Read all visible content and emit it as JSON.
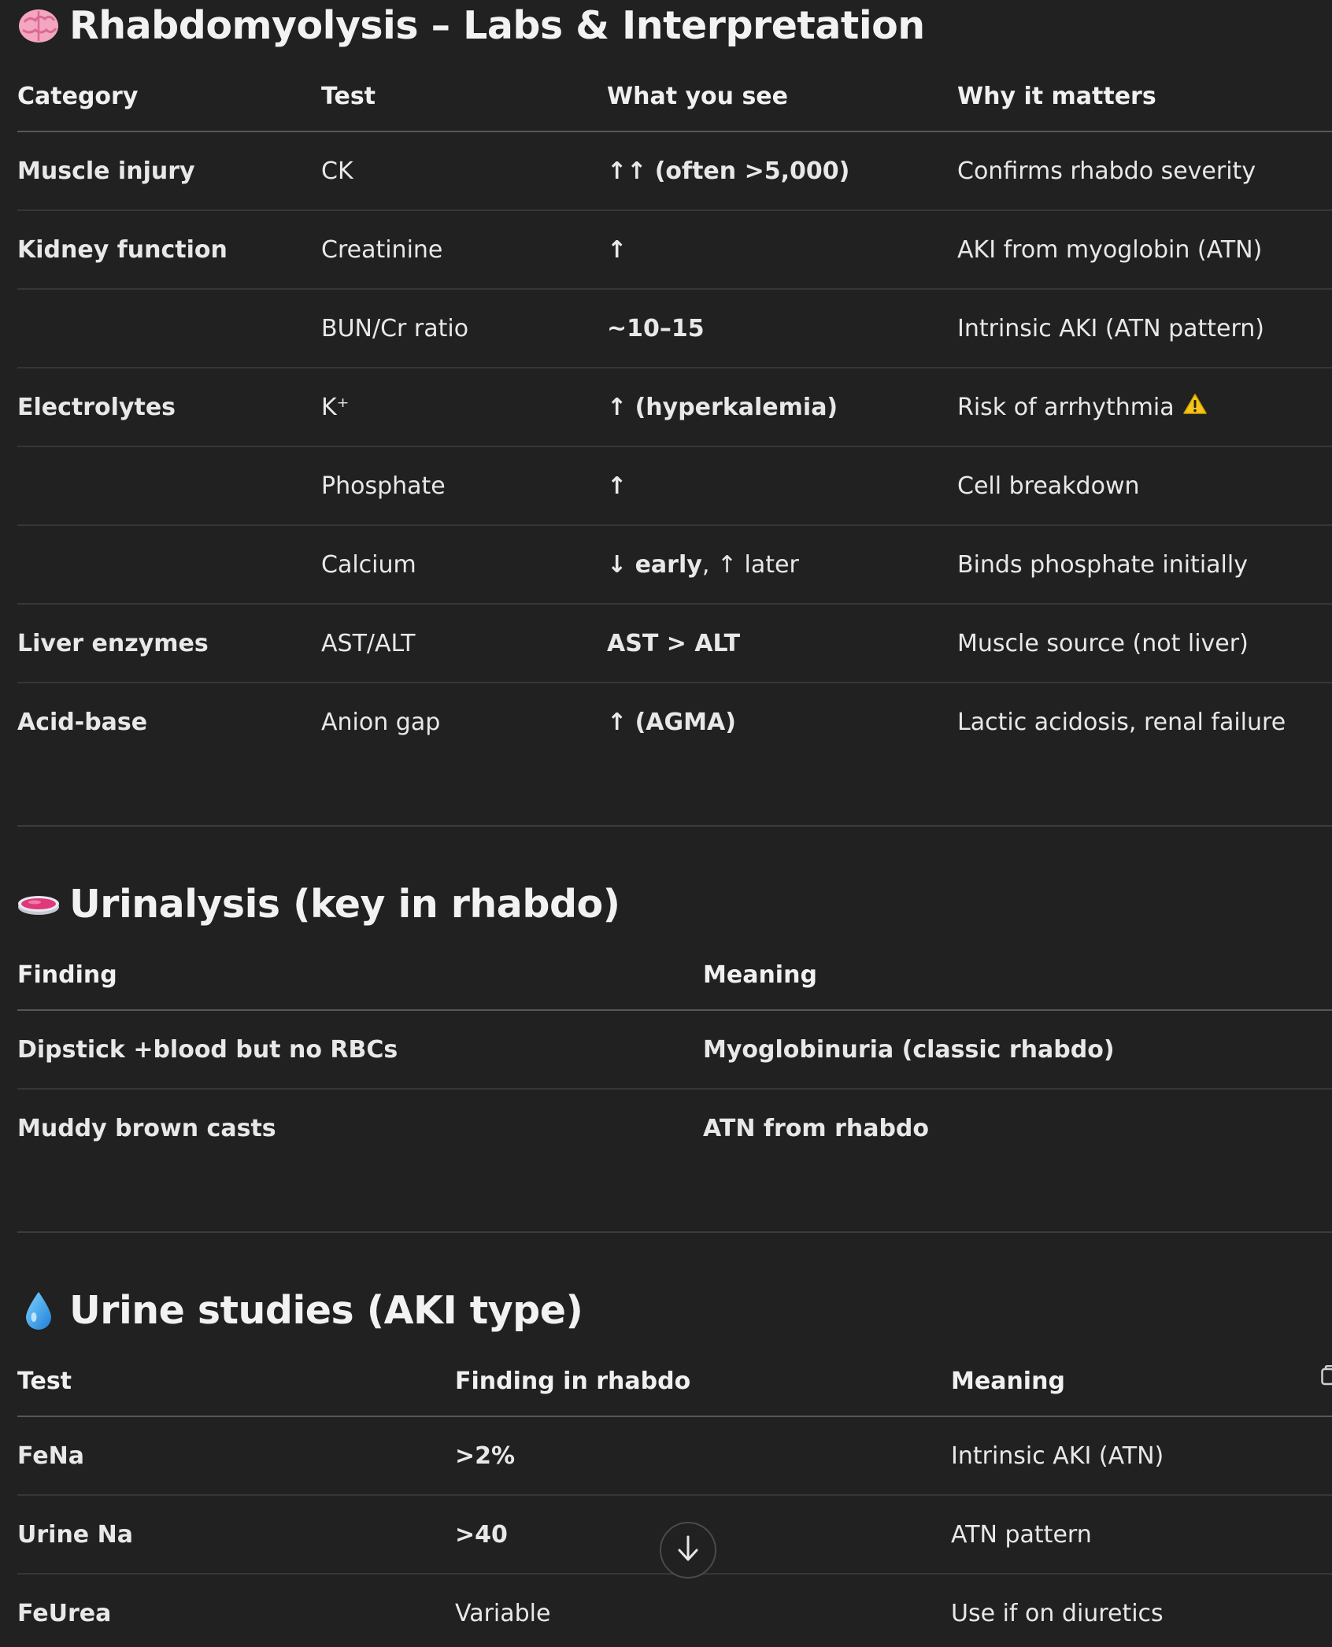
{
  "section1": {
    "emoji": "brain-icon",
    "title": "Rhabdomyolysis – Labs & Interpretation",
    "headers": [
      "Category",
      "Test",
      "What you see",
      "Why it matters"
    ],
    "rows": [
      {
        "category": "Muscle injury",
        "test": "CK",
        "see": "↑↑ (often >5,000)",
        "why": "Confirms rhabdo severity"
      },
      {
        "category": "Kidney function",
        "test": "Creatinine",
        "see": "↑",
        "why": "AKI from myoglobin (ATN)"
      },
      {
        "category": "",
        "test": "BUN/Cr ratio",
        "see": "~10–15",
        "why": "Intrinsic AKI (ATN pattern)"
      },
      {
        "category": "Electrolytes",
        "test": "K⁺",
        "see": "↑ (hyperkalemia)",
        "why": "Risk of arrhythmia"
      },
      {
        "category": "",
        "test": "Phosphate",
        "see": "↑",
        "why": "Cell breakdown"
      },
      {
        "category": "",
        "test": "Calcium",
        "see_bold": "↓ early",
        "see_rest": ", ↑ later",
        "why": "Binds phosphate initially"
      },
      {
        "category": "Liver enzymes",
        "test": "AST/ALT",
        "see": "AST > ALT",
        "why": "Muscle source (not liver)"
      },
      {
        "category": "Acid-base",
        "test": "Anion gap",
        "see": "↑ (AGMA)",
        "why": "Lactic acidosis, renal failure"
      }
    ],
    "warning_icon": "warning-icon"
  },
  "section2": {
    "emoji": "petri-dish-icon",
    "title": "Urinalysis (key in rhabdo)",
    "headers": [
      "Finding",
      "Meaning"
    ],
    "rows": [
      {
        "finding": "Dipstick +blood but no RBCs",
        "meaning": "Myoglobinuria (classic rhabdo)"
      },
      {
        "finding": "Muddy brown casts",
        "meaning": "ATN from rhabdo"
      }
    ]
  },
  "section3": {
    "emoji": "droplet-icon",
    "title": "Urine studies (AKI type)",
    "headers": [
      "Test",
      "Finding in rhabdo",
      "Meaning"
    ],
    "rows": [
      {
        "test": "FeNa",
        "finding": ">2%",
        "meaning": "Intrinsic AKI (ATN)"
      },
      {
        "test": "Urine Na",
        "finding": ">40",
        "meaning": "ATN pattern"
      },
      {
        "test": "FeUrea",
        "finding": "Variable",
        "meaning": "Use if on diuretics"
      }
    ]
  },
  "controls": {
    "scroll_down_icon": "arrow-down-icon",
    "copy_icon": "copy-icon"
  },
  "colors": {
    "background": "#212121",
    "text": "#ececec",
    "divider": "#363636",
    "warning": "#f5c518"
  }
}
